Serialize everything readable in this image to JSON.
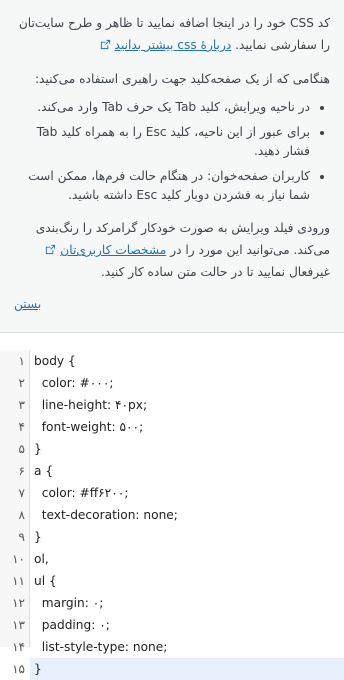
{
  "help": {
    "p1": "کد CSS خود را در اینجا اضافه نمایید تا ظاهر و طرح سایت‌تان را سفارشی نمایید.",
    "p1_link": "دربارهٔ css بیشتر بدانید",
    "p2": "هنگامی که از یک صفحه‌کلید جهت راهبری استفاده می‌کنید:",
    "bullets": [
      "در ناحیه ویرایش، کلید Tab یک حرف Tab وارد می‌کند.",
      "برای عبور از این ناحیه، کلید Esc را به همراه کلید Tab فشار دهید.",
      "کاربران صفحه‌خوان: در هنگام حالت فرم‌ها، ممکن است شما نیاز به فشردن دوبار کلید Esc داشته باشید."
    ],
    "p3_a": "ورودی فیلد ویرایش به صورت خودکار گرامرکد را رنگ‌بندی می‌کند. می‌توانید این مورد را در",
    "p3_link": "مشخصات کاربری‌تان",
    "p3_b": "غیرفعال نمایید تا در حالت متن ساده کار کنید.",
    "close": "بستن"
  },
  "editor": {
    "line_numbers": [
      "۱",
      "۲",
      "۳",
      "۴",
      "۵",
      "۶",
      "۷",
      "۸",
      "۹",
      "۱۰",
      "۱۱",
      "۱۲",
      "۱۳",
      "۱۴",
      "۱۵"
    ],
    "lines": [
      "body {",
      "  color: #۰۰۰;",
      "  line-height: ۴۰px;",
      "  font-weight: ۵۰۰;",
      "}",
      "a {",
      "  color: #ff۶۲۰۰;",
      "  text-decoration: none;",
      "}",
      "ol,",
      "ul {",
      "  margin: ۰;",
      "  padding: ۰;",
      "  list-style-type: none;",
      "}"
    ]
  }
}
